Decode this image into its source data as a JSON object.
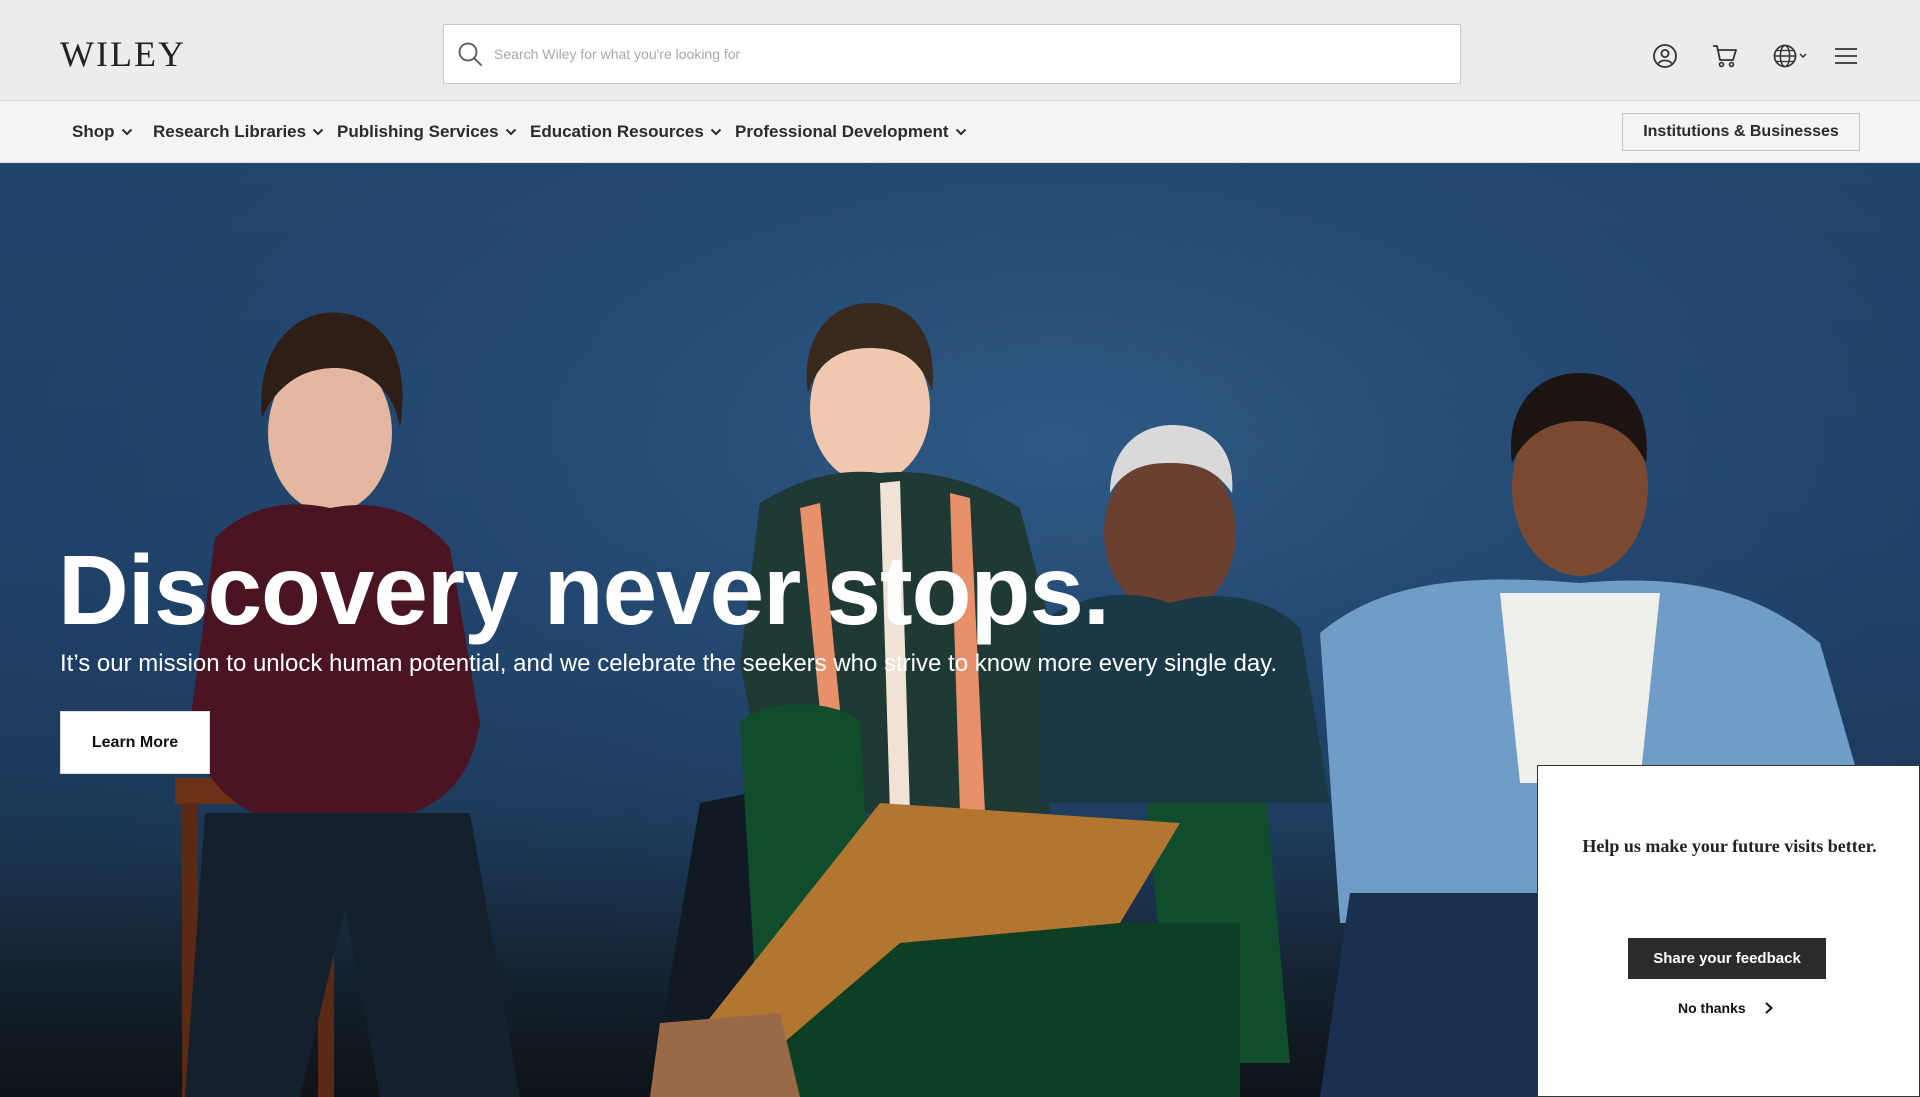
{
  "header": {
    "logo_text": "WILEY",
    "search": {
      "placeholder": "Search Wiley for what you're looking for"
    },
    "icons": [
      "account-icon",
      "cart-icon",
      "globe-icon",
      "menu-icon"
    ]
  },
  "nav": {
    "items": [
      {
        "label": "Shop"
      },
      {
        "label": "Research Libraries"
      },
      {
        "label": "Publishing Services"
      },
      {
        "label": "Education Resources"
      },
      {
        "label": "Professional Development"
      }
    ],
    "institutions_label": "Institutions & Businesses"
  },
  "hero": {
    "title": "Discovery never stops.",
    "subtitle": "It’s our mission to unlock human potential, and we celebrate the seekers who strive to know more every single day.",
    "cta_label": "Learn More"
  },
  "feedback": {
    "message": "Help us make your future visits better.",
    "share_label": "Share your feedback",
    "dismiss_label": "No thanks"
  },
  "colors": {
    "header_bg": "#ececec",
    "nav_bg": "#f4f4f4",
    "hero_bg": "#23466d",
    "feedback_button": "#2b2b2b"
  }
}
